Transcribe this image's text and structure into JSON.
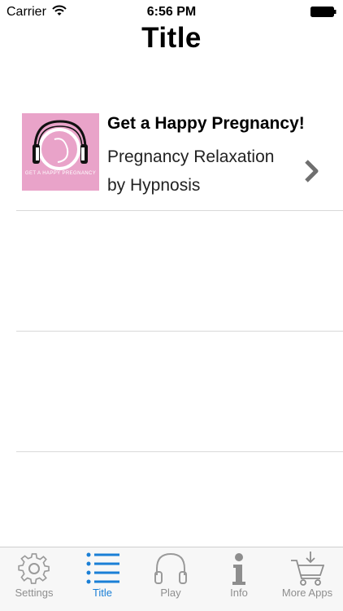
{
  "status_bar": {
    "carrier": "Carrier",
    "time": "6:56 PM"
  },
  "nav": {
    "title": "Title"
  },
  "list": {
    "items": [
      {
        "title": "Get a Happy Pregnancy!",
        "subtitle_line1": "Pregnancy Relaxation",
        "subtitle_line2": "by Hypnosis",
        "cover_caption": "GET A HAPPY PREGNANCY",
        "cover_color": "#e9a3c9"
      }
    ]
  },
  "tab_bar": {
    "active_color": "#1a7fd6",
    "inactive_color": "#8e8e8e",
    "tabs": [
      {
        "label": "Settings",
        "icon": "gear-icon",
        "active": false
      },
      {
        "label": "Title",
        "icon": "list-icon",
        "active": true
      },
      {
        "label": "Play",
        "icon": "headphones-icon",
        "active": false
      },
      {
        "label": "Info",
        "icon": "info-icon",
        "active": false
      },
      {
        "label": "More Apps",
        "icon": "cart-icon",
        "active": false
      }
    ]
  }
}
